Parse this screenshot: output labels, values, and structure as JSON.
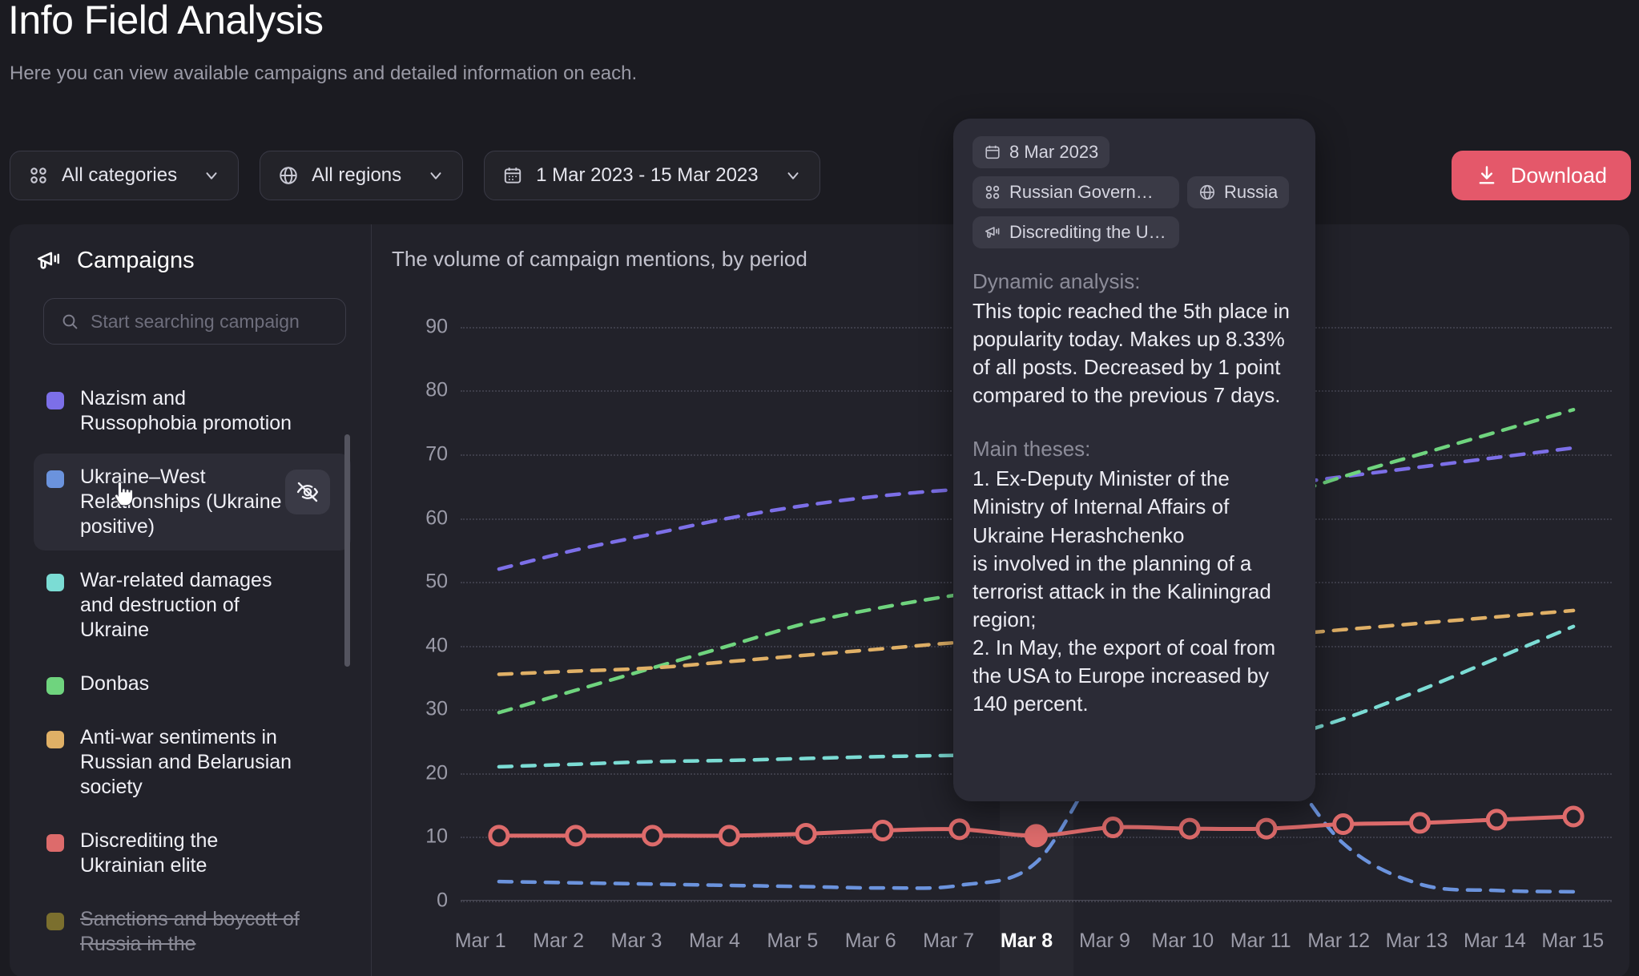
{
  "header": {
    "title": "Info Field Analysis",
    "subtitle": "Here you can view available campaigns and detailed information on each."
  },
  "filters": [
    {
      "icon": "categories-grid-icon",
      "label": "All categories"
    },
    {
      "icon": "globe-icon",
      "label": "All regions"
    },
    {
      "icon": "calendar-icon",
      "label": "1 Mar 2023 - 15 Mar 2023"
    }
  ],
  "download": {
    "label": "Download",
    "icon": "download-icon",
    "color": "#e4586a"
  },
  "sidebar": {
    "title": "Campaigns",
    "icon": "megaphone-icon",
    "search": {
      "placeholder": "Start searching campaign",
      "value": ""
    },
    "items": [
      {
        "label": "Nazism and Russophobia promotion",
        "color": "#7c6fe8",
        "state": "normal"
      },
      {
        "label": "Ukraine–West Relationships (Ukraine positive)",
        "color": "#6b93dd",
        "state": "hovered"
      },
      {
        "label": "War-related damages and destruction of Ukraine",
        "color": "#7bdcd4",
        "state": "normal"
      },
      {
        "label": "Donbas",
        "color": "#6fd47e",
        "state": "normal"
      },
      {
        "label": "Anti-war sentiments in Russian and Belarusian society",
        "color": "#e0b066",
        "state": "normal"
      },
      {
        "label": "Discrediting the Ukrainian elite",
        "color": "#dd6b6b",
        "state": "normal"
      },
      {
        "label": "Sanctions and boycott of Russia in the",
        "color": "#9a8a30",
        "state": "disabled"
      }
    ],
    "hide_button_icon": "eye-off-icon"
  },
  "tooltip": {
    "chips": [
      {
        "icon": "calendar-icon",
        "label": "8 Mar 2023"
      },
      {
        "icon": "categories-grid-icon",
        "label": "Russian Governm…"
      },
      {
        "icon": "globe-icon",
        "label": "Russia"
      },
      {
        "icon": "megaphone-icon",
        "label": "Discrediting the Ukrai…"
      }
    ],
    "dynamic_heading": "Dynamic analysis:",
    "dynamic_text": "This topic reached the 5th place in popularity today. Makes up 8.33% of all posts. Decreased by 1 point compared to the previous 7 days.",
    "theses_heading": "Main theses:",
    "theses_text": "1. Ex-Deputy Minister of the Ministry of Internal Affairs of Ukraine Herashchenko\n is involved in the planning of a terrorist attack in the Kaliningrad region;\n2. In May, the export of coal from the USA to Europe increased by 140 percent."
  },
  "chart_data": {
    "type": "line",
    "title": "The volume of campaign mentions, by period",
    "xlabel": "",
    "ylabel": "",
    "ylim": [
      0,
      95
    ],
    "yticks": [
      0,
      10,
      20,
      30,
      40,
      50,
      60,
      70,
      80,
      90
    ],
    "grid": true,
    "legend": "sidebar",
    "selected_x": "Mar 8",
    "categories": [
      "Mar 1",
      "Mar 2",
      "Mar 3",
      "Mar 4",
      "Mar 5",
      "Mar 6",
      "Mar 7",
      "Mar 8",
      "Mar 9",
      "Mar 10",
      "Mar 11",
      "Mar 12",
      "Mar 13",
      "Mar 14",
      "Mar 15"
    ],
    "series": [
      {
        "name": "Nazism and Russophobia promotion",
        "color": "#7c6fe8",
        "style": "dashed",
        "values": [
          52,
          55,
          57.5,
          60,
          62,
          63.5,
          64.5,
          65,
          64.5,
          64,
          65,
          66.5,
          68,
          69.5,
          71
        ]
      },
      {
        "name": "Ukraine–West Relationships (Ukraine positive)",
        "color": "#6b93dd",
        "style": "dashed",
        "values": [
          3,
          2.8,
          2.6,
          2.4,
          2.2,
          2,
          2.4,
          6,
          24,
          30,
          24,
          9,
          2.6,
          1.6,
          1.4
        ]
      },
      {
        "name": "War-related damages and destruction of Ukraine",
        "color": "#7bdcd4",
        "style": "dashed",
        "values": [
          21,
          21.4,
          21.8,
          22,
          22.3,
          22.6,
          22.8,
          23,
          23,
          23.5,
          25,
          28.5,
          33,
          38,
          43
        ]
      },
      {
        "name": "Donbas",
        "color": "#6fd47e",
        "style": "dashed",
        "values": [
          29.5,
          33,
          36.5,
          40,
          43.5,
          46,
          48,
          49.5,
          53.5,
          58.5,
          62.5,
          66.5,
          70,
          73.5,
          77
        ]
      },
      {
        "name": "Anti-war sentiments in Russian and Belarusian society",
        "color": "#e0b066",
        "style": "dashed",
        "values": [
          35.5,
          36,
          36.5,
          37.5,
          38.5,
          39.5,
          40.5,
          41,
          41.5,
          41,
          41.5,
          42.5,
          43.5,
          44.5,
          45.5
        ]
      },
      {
        "name": "Discrediting the Ukrainian elite",
        "color": "#dd6b6b",
        "style": "solid",
        "values": [
          10.2,
          10.2,
          10.2,
          10.2,
          10.5,
          11,
          11.2,
          10.2,
          11.5,
          11.3,
          11.3,
          12,
          12.2,
          12.7,
          13.2
        ]
      }
    ]
  }
}
